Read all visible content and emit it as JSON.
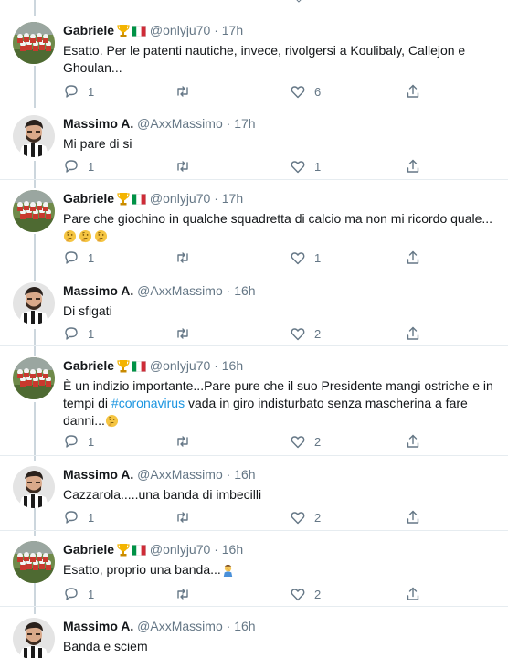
{
  "tweets": [
    {
      "name": "Gabriele",
      "handle": "@onlyju70",
      "time": "17h",
      "has_badges": true,
      "text": "Esatto. Per le patenti nautiche, invece, rivolgersi a Koulibaly, Callejon e Ghoulan...",
      "replies": "1",
      "retweets": "",
      "likes": "6"
    },
    {
      "name": "Massimo A.",
      "handle": "@AxxMassimo",
      "time": "17h",
      "has_badges": false,
      "text": "Mi pare di si",
      "replies": "1",
      "retweets": "",
      "likes": "1"
    },
    {
      "name": "Gabriele",
      "handle": "@onlyju70",
      "time": "17h",
      "has_badges": true,
      "text": "Pare che giochino in qualche squadretta di calcio ma non mi ricordo quale...",
      "emojis": [
        "thinking-face",
        "thinking-face",
        "thinking-face"
      ],
      "replies": "1",
      "retweets": "",
      "likes": "1"
    },
    {
      "name": "Massimo A.",
      "handle": "@AxxMassimo",
      "time": "16h",
      "has_badges": false,
      "text": "Di sfigati",
      "replies": "1",
      "retweets": "",
      "likes": "2"
    },
    {
      "name": "Gabriele",
      "handle": "@onlyju70",
      "time": "16h",
      "has_badges": true,
      "text_before": "È un indizio importante...Pare pure che il suo Presidente mangi ostriche e in tempi di ",
      "hashtag": "#coronavirus",
      "text_after": " vada in giro indisturbato senza mascherina a fare danni...",
      "emojis": [
        "thinking-face"
      ],
      "replies": "1",
      "retweets": "",
      "likes": "2"
    },
    {
      "name": "Massimo A.",
      "handle": "@AxxMassimo",
      "time": "16h",
      "has_badges": false,
      "text": "Cazzarola.....una banda di imbecilli",
      "replies": "1",
      "retweets": "",
      "likes": "2"
    },
    {
      "name": "Gabriele",
      "handle": "@onlyju70",
      "time": "16h",
      "has_badges": true,
      "text": "Esatto, proprio una banda...",
      "emojis": [
        "man-facepalming"
      ],
      "replies": "1",
      "retweets": "",
      "likes": "2"
    },
    {
      "name": "Massimo A.",
      "handle": "@AxxMassimo",
      "time": "16h",
      "has_badges": false,
      "text": "Banda e sciem"
    }
  ],
  "colors": {
    "accent": "#1b95e0",
    "secondary_text": "#657786",
    "divider": "#e6ecf0",
    "thread_line": "#ccd6dd"
  },
  "icons": {
    "reply": "reply-icon",
    "retweet": "retweet-icon",
    "like": "heart-icon",
    "share": "share-icon"
  }
}
